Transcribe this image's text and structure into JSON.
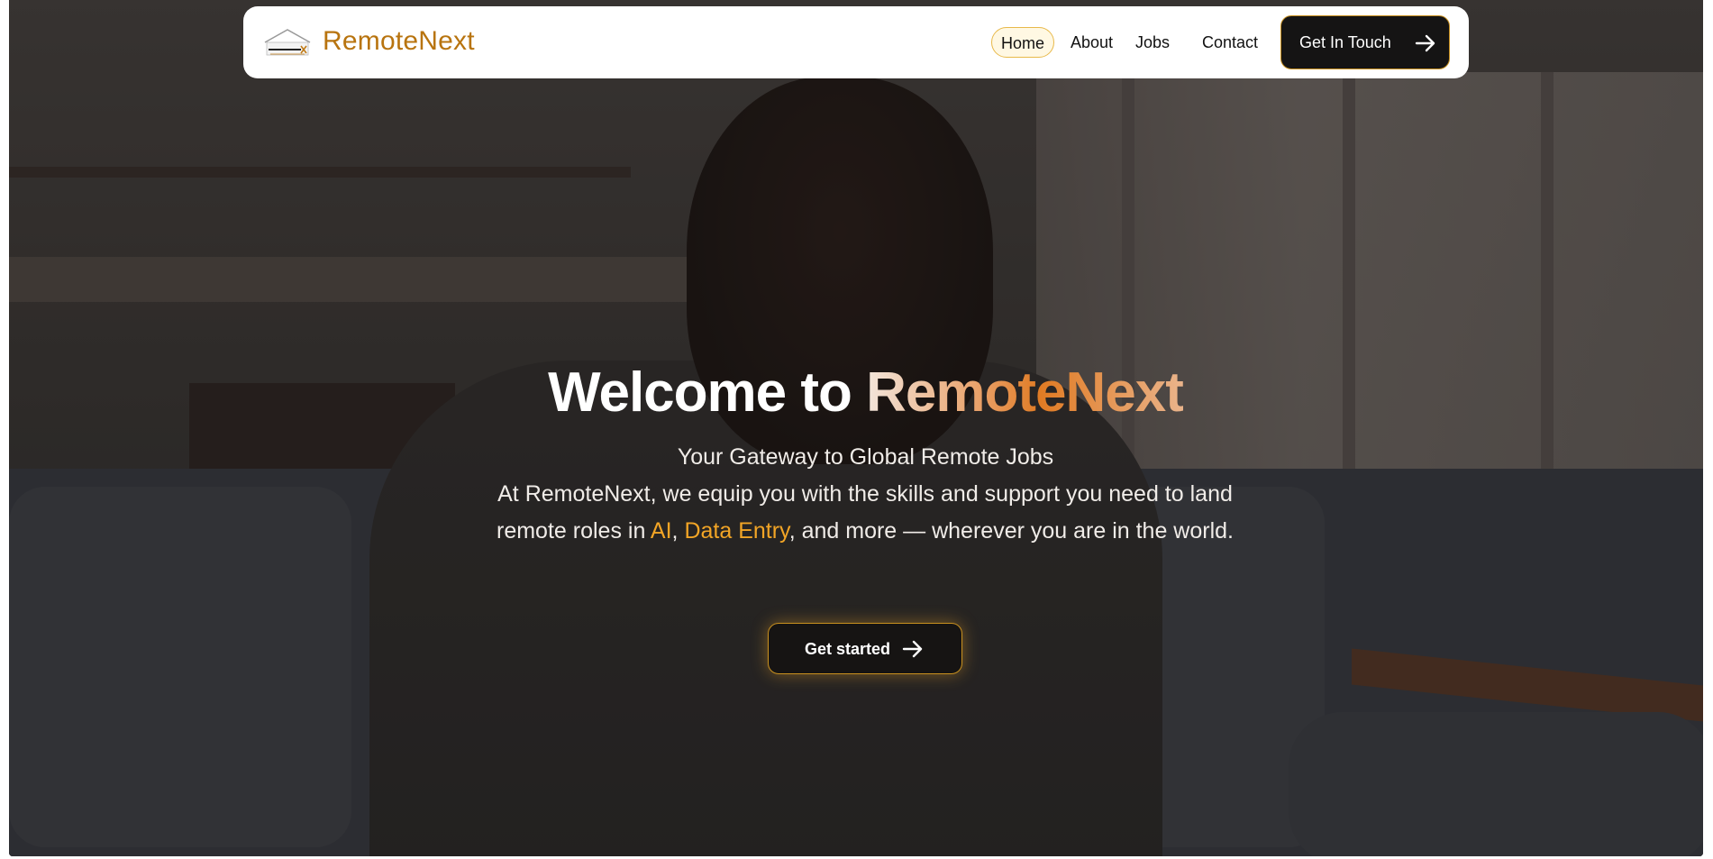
{
  "nav": {
    "brand": "RemoteNext",
    "items": [
      {
        "label": "Home",
        "active": true
      },
      {
        "label": "About"
      },
      {
        "label": "Jobs"
      },
      {
        "label": "Contact"
      }
    ],
    "cta_label": "Get In Touch",
    "logo_icon": "house-logo-icon"
  },
  "hero": {
    "headline_prefix": "Welcome to ",
    "headline_brand": "RemoteNext",
    "tagline": "Your Gateway to Global Remote Jobs",
    "desc_part1": "At RemoteNext, we equip you with the skills and support you need to land remote roles in ",
    "highlight1": "AI",
    "comma": ", ",
    "highlight2": "Data Entry",
    "desc_part2": ", and more — wherever you are in the world.",
    "cta_label": "Get started"
  },
  "colors": {
    "accent": "#f2a526",
    "brand_text": "#b8740f",
    "button_bg": "#151414",
    "button_border": "#c8901f"
  }
}
